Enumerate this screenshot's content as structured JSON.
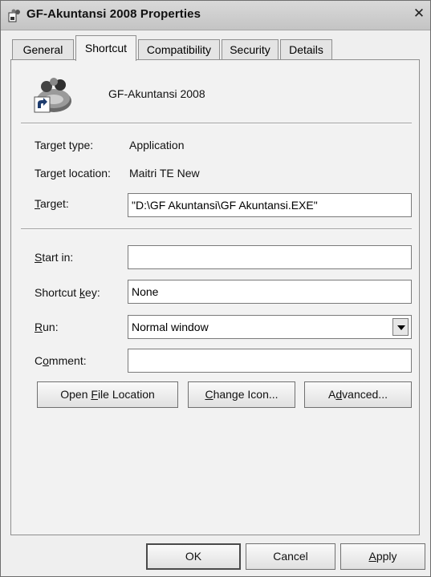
{
  "window": {
    "title": "GF-Akuntansi 2008 Properties",
    "close_glyph": "✕"
  },
  "tabs": [
    {
      "label": "General"
    },
    {
      "label": "Shortcut"
    },
    {
      "label": "Compatibility"
    },
    {
      "label": "Security"
    },
    {
      "label": "Details"
    }
  ],
  "shortcut": {
    "name": "GF-Akuntansi 2008",
    "target_type": {
      "label": "Target type:",
      "value": "Application"
    },
    "target_location": {
      "label": "Target location:",
      "value": "Maitri TE New"
    },
    "target": {
      "label_pre": "",
      "label_key": "T",
      "label_post": "arget:",
      "value": "\"D:\\GF Akuntansi\\GF Akuntansi.EXE\""
    },
    "start_in": {
      "label_pre": "",
      "label_key": "S",
      "label_post": "tart in:",
      "value": ""
    },
    "shortcut_key": {
      "label_pre": "Shortcut ",
      "label_key": "k",
      "label_post": "ey:",
      "value": "None"
    },
    "run": {
      "label_pre": "",
      "label_key": "R",
      "label_post": "un:",
      "value": "Normal window"
    },
    "comment": {
      "label_pre": "C",
      "label_key": "o",
      "label_post": "mment:",
      "value": ""
    }
  },
  "actions": {
    "open_file_location": {
      "pre": "Open ",
      "key": "F",
      "post": "ile Location"
    },
    "change_icon": {
      "pre": "",
      "key": "C",
      "post": "hange Icon..."
    },
    "advanced": {
      "pre": "A",
      "key": "d",
      "post": "vanced..."
    }
  },
  "footer": {
    "ok": "OK",
    "cancel": "Cancel",
    "apply": {
      "pre": "",
      "key": "A",
      "post": "pply"
    }
  },
  "icons": {
    "app": "users-globe-icon",
    "shortcut_overlay": "shortcut-arrow-icon",
    "title": "app-window-icon"
  }
}
